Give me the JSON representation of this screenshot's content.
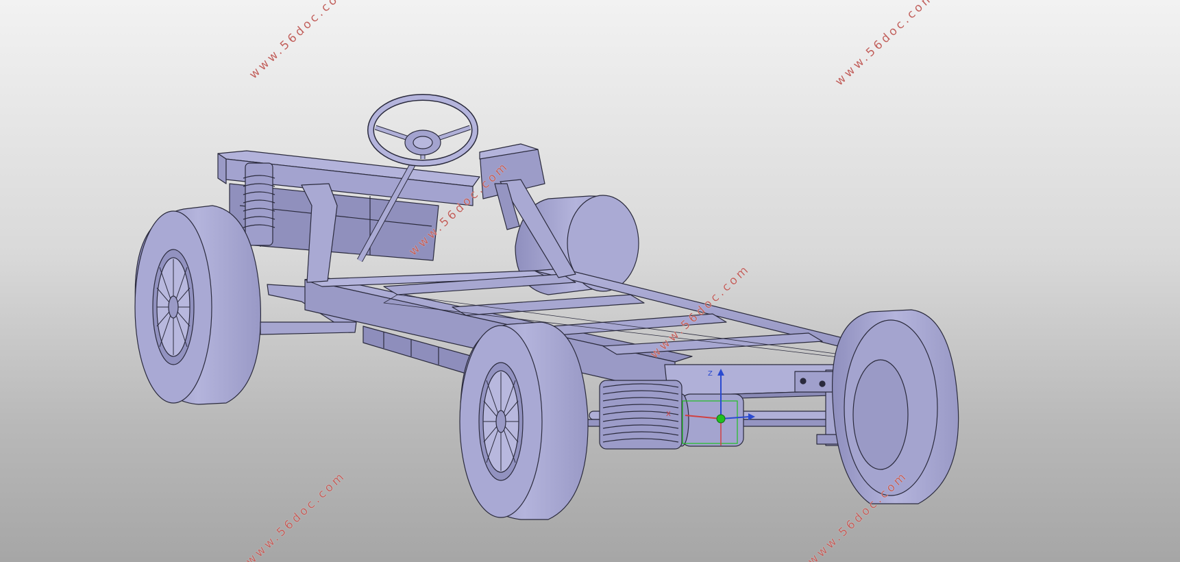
{
  "viewport": {
    "background_top": "#f2f2f2",
    "background_bottom": "#a6a6a6",
    "model_color": "#a7a7d2",
    "model_edge_color": "#2a2a3c"
  },
  "watermarks": [
    {
      "text": "www.56doc.com"
    },
    {
      "text": "www.56doc.com"
    },
    {
      "text": "www.56doc.com"
    },
    {
      "text": "www.56doc.com"
    },
    {
      "text": "www.56doc.com"
    },
    {
      "text": "www.56doc.com"
    }
  ],
  "triad": {
    "x_label": "X",
    "z_label": "Z",
    "x_color": "#d04040",
    "y_color": "#2a4ad0",
    "z_color": "#2a4ad0",
    "origin_color": "#20c020"
  },
  "model": {
    "icons": [
      "chassis-frame",
      "steering-wheel",
      "front-wheel",
      "rear-wheel",
      "coil-spring",
      "axle"
    ]
  }
}
